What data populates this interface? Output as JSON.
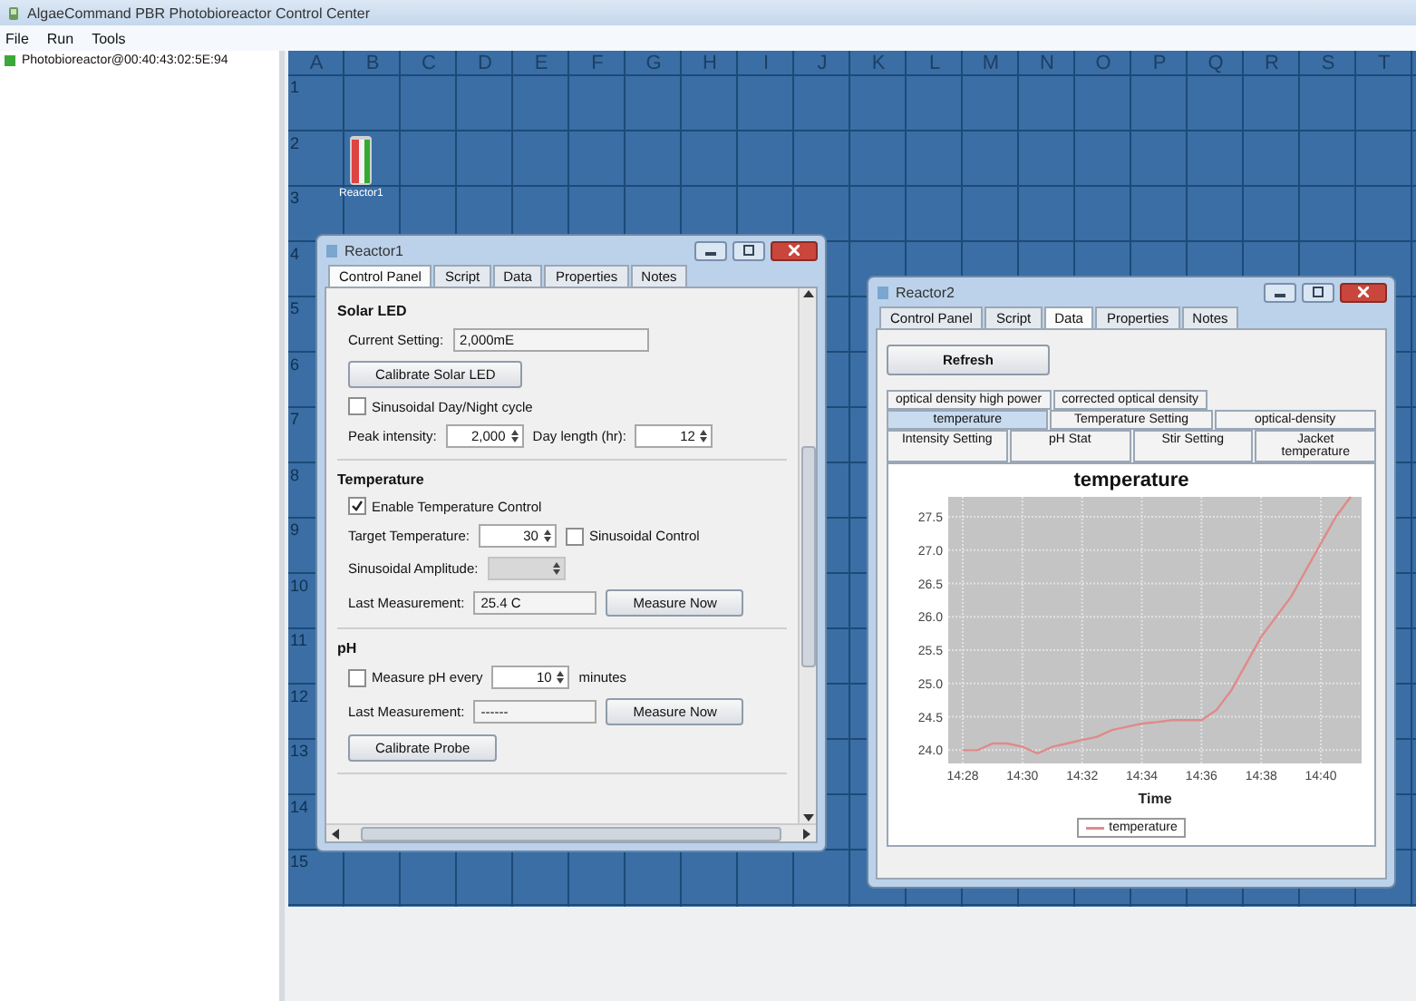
{
  "window": {
    "title": "AlgaeCommand PBR Photobioreactor Control Center"
  },
  "menu": [
    "File",
    "Run",
    "Tools"
  ],
  "tree": [
    {
      "label": "Photobioreactor@00:40:43:02:5E:94"
    }
  ],
  "grid": {
    "columns": [
      "A",
      "B",
      "C",
      "D",
      "E",
      "F",
      "G",
      "H",
      "I",
      "J",
      "K",
      "L",
      "M",
      "N",
      "O",
      "P",
      "Q",
      "R",
      "S",
      "T"
    ],
    "rows": [
      "1",
      "2",
      "3",
      "4",
      "5",
      "6",
      "7",
      "8",
      "9",
      "10",
      "11",
      "12",
      "13",
      "14",
      "15"
    ]
  },
  "reactor_icon": {
    "label": "Reactor1"
  },
  "windows": [
    {
      "title": "Reactor1",
      "tabs": [
        {
          "label": "Control Panel",
          "selected": true
        },
        {
          "label": "Script",
          "selected": false
        },
        {
          "label": "Data",
          "selected": false
        },
        {
          "label": "Properties",
          "selected": false
        },
        {
          "label": "Notes",
          "selected": false
        }
      ],
      "sections": [
        {
          "title": "Solar LED",
          "rows": [
            [
              {
                "kind": "label",
                "text": "Current Setting:"
              },
              {
                "kind": "field",
                "value": "2,000mE"
              }
            ],
            [
              {
                "kind": "button",
                "text": "Calibrate Solar LED"
              }
            ],
            [
              {
                "kind": "checkbox",
                "text": "Sinusoidal Day/Night cycle",
                "checked": false
              }
            ],
            [
              {
                "kind": "label",
                "text": "Peak intensity:"
              },
              {
                "kind": "spinner",
                "value": "2,000",
                "disabled": false
              },
              {
                "kind": "label",
                "text": "Day length (hr):"
              },
              {
                "kind": "spinner",
                "value": "12",
                "disabled": false
              }
            ]
          ]
        },
        {
          "title": "Temperature",
          "rows": [
            [
              {
                "kind": "checkbox",
                "text": "Enable Temperature Control",
                "checked": true
              }
            ],
            [
              {
                "kind": "label",
                "text": "Target Temperature:"
              },
              {
                "kind": "spinner",
                "value": "30",
                "disabled": false
              },
              {
                "kind": "checkbox",
                "text": "Sinusoidal Control",
                "checked": false
              }
            ],
            [
              {
                "kind": "label",
                "text": "Sinusoidal Amplitude:"
              },
              {
                "kind": "spinner",
                "disabled": true
              }
            ],
            [
              {
                "kind": "label",
                "text": "Last Measurement:"
              },
              {
                "kind": "field",
                "value": "25.4 C"
              },
              {
                "kind": "button",
                "text": "Measure Now"
              }
            ]
          ]
        },
        {
          "title": "pH",
          "rows": [
            [
              {
                "kind": "checkbox",
                "text": "Measure pH every",
                "checked": false
              },
              {
                "kind": "spinner",
                "value": "10",
                "disabled": false
              },
              {
                "kind": "label",
                "text": "minutes"
              }
            ],
            [
              {
                "kind": "label",
                "text": "Last Measurement:"
              },
              {
                "kind": "field",
                "value": "------"
              },
              {
                "kind": "button",
                "text": "Measure Now"
              }
            ],
            [
              {
                "kind": "button",
                "text": "Calibrate Probe"
              }
            ]
          ]
        }
      ]
    },
    {
      "title": "Reactor2",
      "tabs": [
        {
          "label": "Control Panel",
          "selected": false
        },
        {
          "label": "Script",
          "selected": false
        },
        {
          "label": "Data",
          "selected": true
        },
        {
          "label": "Properties",
          "selected": false
        },
        {
          "label": "Notes",
          "selected": false
        }
      ],
      "refresh_button": "Refresh",
      "subtab_rows": [
        [
          {
            "label": "optical density high power",
            "selected": false
          },
          {
            "label": "corrected optical density",
            "selected": false
          }
        ],
        [
          {
            "label": "temperature",
            "selected": true
          },
          {
            "label": "Temperature Setting",
            "selected": false
          },
          {
            "label": "optical-density",
            "selected": false
          }
        ],
        [
          {
            "label": "Intensity Setting",
            "selected": false
          },
          {
            "label": "pH Stat",
            "selected": false
          },
          {
            "label": "Stir Setting",
            "selected": false
          },
          {
            "label": "Jacket temperature",
            "selected": false
          }
        ]
      ],
      "chart_data": {
        "type": "line",
        "title": "temperature",
        "xlabel": "Time",
        "categories": [
          "14:28",
          null,
          null,
          null,
          "14:30",
          null,
          null,
          null,
          "14:32",
          null,
          null,
          null,
          "14:34",
          null,
          null,
          null,
          "14:36",
          null,
          null,
          null,
          "14:38",
          null,
          null,
          null,
          "14:40",
          null,
          null
        ],
        "series": [
          {
            "name": "temperature",
            "color": "#e08a8a",
            "values": [
              24.0,
              24.0,
              24.1,
              24.1,
              24.05,
              23.95,
              24.05,
              24.1,
              24.15,
              24.2,
              24.3,
              24.35,
              24.4,
              24.42,
              24.45,
              24.45,
              24.45,
              24.6,
              24.9,
              25.3,
              25.7,
              26.0,
              26.3,
              26.7,
              27.1,
              27.5,
              27.8
            ]
          }
        ],
        "ylim": [
          23.8,
          27.8
        ],
        "grid": true,
        "yticks": [
          {
            "value": 24,
            "label": "24.0"
          },
          {
            "value": 24.5,
            "label": "24.5"
          },
          {
            "value": 25,
            "label": "25.0"
          },
          {
            "value": 25.5,
            "label": "25.5"
          },
          {
            "value": 26,
            "label": "26.0"
          },
          {
            "value": 26.5,
            "label": "26.5"
          },
          {
            "value": 27,
            "label": "27.0"
          },
          {
            "value": 27.5,
            "label": "27.5"
          }
        ]
      }
    }
  ]
}
